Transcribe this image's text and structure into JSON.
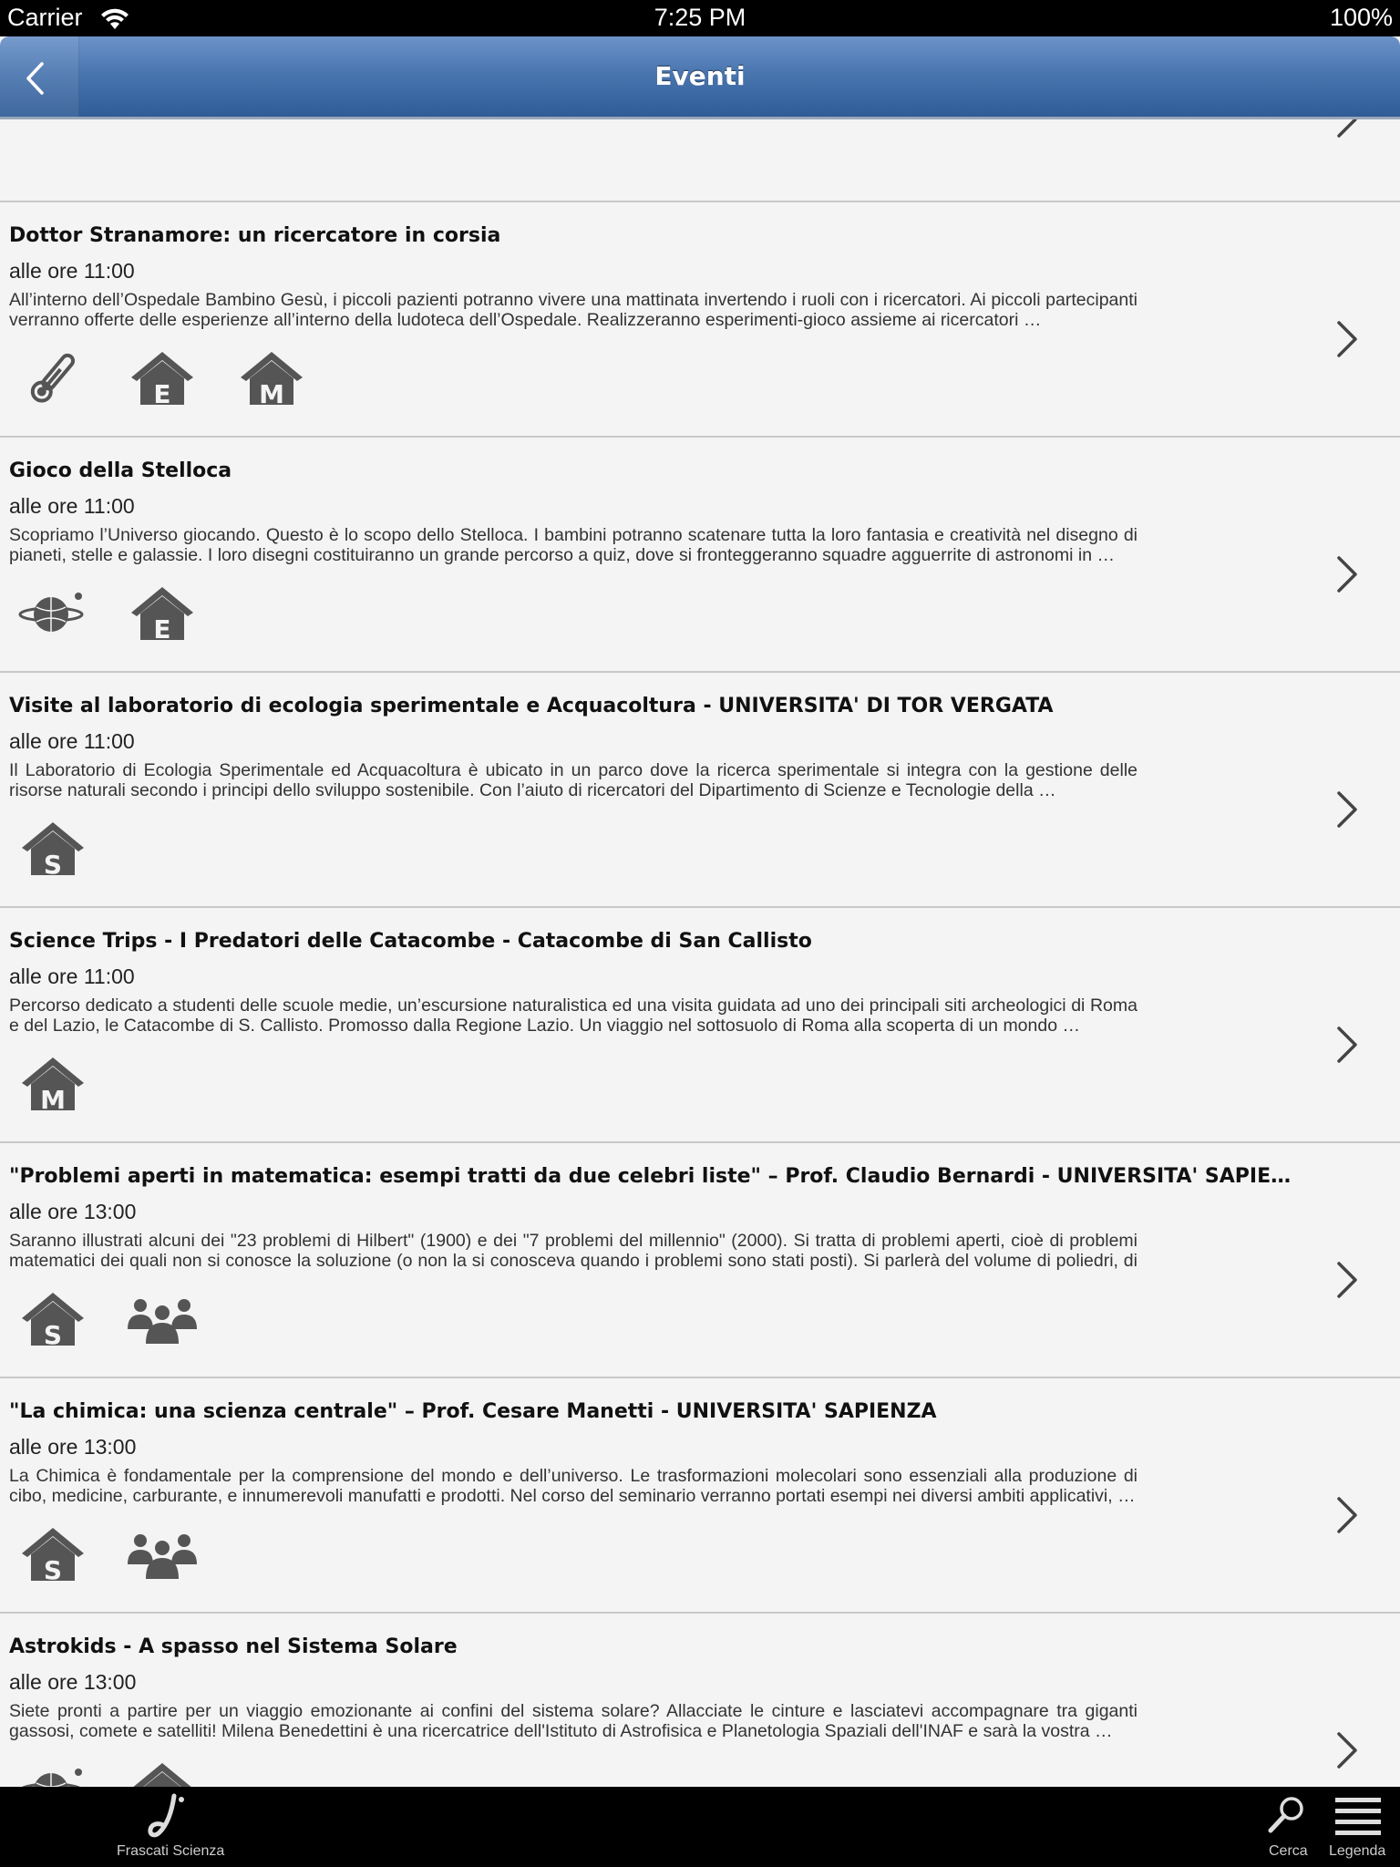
{
  "status_bar": {
    "carrier": "Carrier",
    "time": "7:25 PM",
    "battery": "100%"
  },
  "nav": {
    "title": "Eventi"
  },
  "events": [
    {
      "title": "Dottor Stranamore: un ricercatore in corsia",
      "time": "alle ore 11:00",
      "description": "All’interno dell’Ospedale Bambino Gesù, i piccoli pazienti potranno vivere una mattinata invertendo i ruoli con i ricercatori. Ai piccoli partecipanti verranno offerte delle esperienze all’interno della ludoteca dell’Ospedale. Realizzeranno esperimenti-gioco assieme ai ricercatori …",
      "icons": [
        "thermometer-icon",
        "house-e-icon",
        "house-m-icon"
      ]
    },
    {
      "title": "Gioco della Stelloca",
      "time": "alle ore 11:00",
      "description": "Scopriamo l’Universo giocando. Questo è lo scopo dello Stelloca. I bambini potranno scatenare tutta la loro fantasia e creatività nel disegno di pianeti, stelle e galassie. I loro disegni costituiranno un grande percorso a quiz, dove si fronteggeranno squadre agguerrite di astronomi in …",
      "icons": [
        "planet-icon",
        "house-e-icon"
      ]
    },
    {
      "title": "Visite al laboratorio di ecologia sperimentale e Acquacoltura - UNIVERSITA' DI TOR VERGATA",
      "time": "alle ore 11:00",
      "description": "Il Laboratorio di Ecologia Sperimentale ed Acquacoltura è ubicato in un parco dove la ricerca sperimentale si integra con la gestione delle risorse naturali secondo i principi dello sviluppo sostenibile. Con l’aiuto di ricercatori del Dipartimento di Scienze e Tecnologie della …",
      "icons": [
        "house-s-icon"
      ]
    },
    {
      "title": "Science Trips - I Predatori delle Catacombe - Catacombe di San Callisto",
      "time": "alle ore 11:00",
      "description": "Percorso dedicato a studenti delle scuole medie, un’escursione naturalistica ed una visita guidata ad uno dei principali siti archeologici di Roma e del Lazio, le Catacombe di S. Callisto. Promosso dalla Regione Lazio. Un viaggio nel sottosuolo di Roma alla scoperta di un mondo …",
      "icons": [
        "house-m-icon"
      ]
    },
    {
      "title": "\"Problemi aperti in matematica: esempi tratti da due celebri liste\" – Prof. Claudio Bernardi - UNIVERSITA' SAPIE…",
      "time": "alle ore 13:00",
      "description": "Saranno illustrati alcuni dei \"23 problemi di Hilbert\" (1900) e dei \"7 problemi del millennio\" (2000). Si tratta di problemi aperti, cioè di problemi matematici dei quali non si conosce la soluzione (o non la si conosceva quando i problemi sono stati posti). Si parlerà del volume di poliedri, di …",
      "icons": [
        "house-s-icon",
        "people-icon"
      ]
    },
    {
      "title": "\"La chimica: una scienza centrale\" – Prof. Cesare Manetti - UNIVERSITA' SAPIENZA",
      "time": "alle ore 13:00",
      "description": "La Chimica è fondamentale per la comprensione del mondo e dell’universo. Le trasformazioni molecolari sono essenziali alla produzione di cibo, medicine, carburante, e innumerevoli manufatti e prodotti. Nel corso del seminario verranno portati esempi nei diversi ambiti applicativi, …",
      "icons": [
        "house-s-icon",
        "people-icon"
      ]
    },
    {
      "title": "Astrokids - A spasso nel Sistema Solare",
      "time": "alle ore 13:00",
      "description": "Siete pronti a partire per un viaggio emozionante ai confini del sistema solare? Allacciate le cinture e lasciatevi accompagnare tra giganti gassosi, comete e satelliti! Milena Benedettini è una ricercatrice dell'Istituto di Astrofisica e Planetologia Spaziali dell'INAF e sarà la vostra …",
      "icons": [
        "planet-icon",
        "house-e-icon"
      ]
    }
  ],
  "tab_bar": {
    "home_label": "Frascati Scienza",
    "search_label": "Cerca",
    "legend_label": "Legenda"
  },
  "colors": {
    "nav_top": "#6c93c9",
    "nav_bottom": "#2f5c96",
    "icon": "#555555",
    "background": "#f4f4f4"
  }
}
